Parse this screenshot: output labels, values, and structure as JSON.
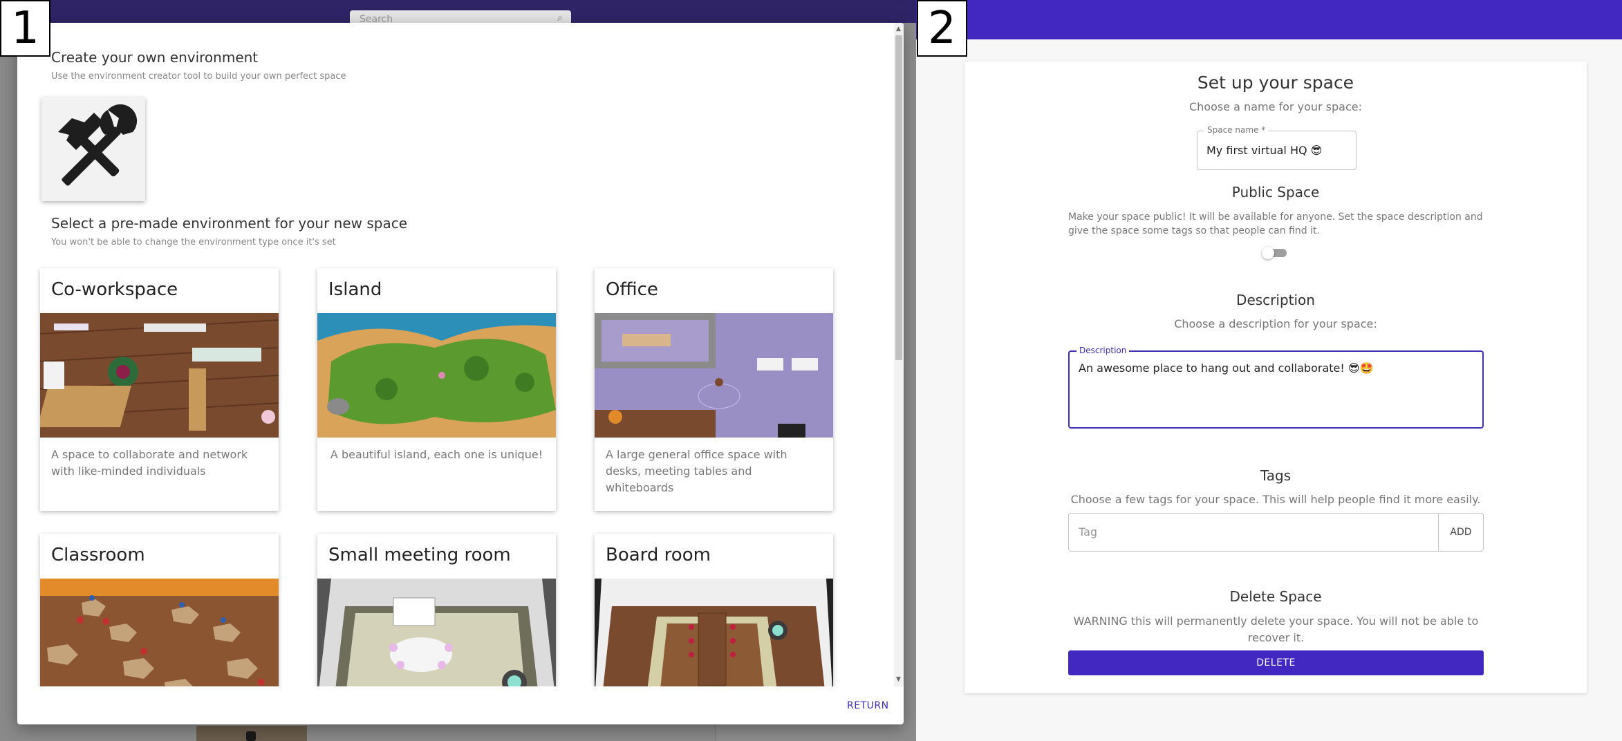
{
  "panel1": {
    "number": "1",
    "background": {
      "search_placeholder": "Search"
    },
    "custom": {
      "title": "Create your own environment",
      "subtitle": "Use the environment creator tool to build your own perfect space",
      "icon": "tools-icon"
    },
    "premade": {
      "title": "Select a pre-made environment for your new space",
      "subtitle": "You won't be able to change the environment type once it's set"
    },
    "environments": [
      {
        "title": "Co-workspace",
        "description": "A space to collaborate and network with like-minded individuals"
      },
      {
        "title": "Island",
        "description": "A beautiful island, each one is unique!"
      },
      {
        "title": "Office",
        "description": "A large general office space with desks, meeting tables and whiteboards"
      },
      {
        "title": "Classroom",
        "description": ""
      },
      {
        "title": "Small meeting room",
        "description": ""
      },
      {
        "title": "Board room",
        "description": ""
      }
    ],
    "return_label": "RETURN"
  },
  "panel2": {
    "number": "2",
    "header": {
      "title": "Set up your space",
      "subtitle": "Choose a name for your space:"
    },
    "name_field": {
      "label": "Space name *",
      "value": "My first virtual HQ 😎"
    },
    "public": {
      "title": "Public Space",
      "text": "Make your space public! It will be available for anyone. Set the space description and give the space some tags so that people can find it.",
      "enabled": false
    },
    "description": {
      "title": "Description",
      "subtitle": "Choose a description for your space:",
      "field_label": "Description",
      "value": "An awesome place to hang out and collaborate! 😎🤩"
    },
    "tags": {
      "title": "Tags",
      "subtitle": "Choose a few tags for your space. This will help people find it more easily.",
      "placeholder": "Tag",
      "add_label": "ADD"
    },
    "delete": {
      "title": "Delete Space",
      "warning": "WARNING this will permanently delete your space. You will not be able to recover it.",
      "button_label": "DELETE"
    }
  },
  "colors": {
    "accent": "#4327c1",
    "background_bar": "#2f2466",
    "link": "#3f2fb5"
  }
}
